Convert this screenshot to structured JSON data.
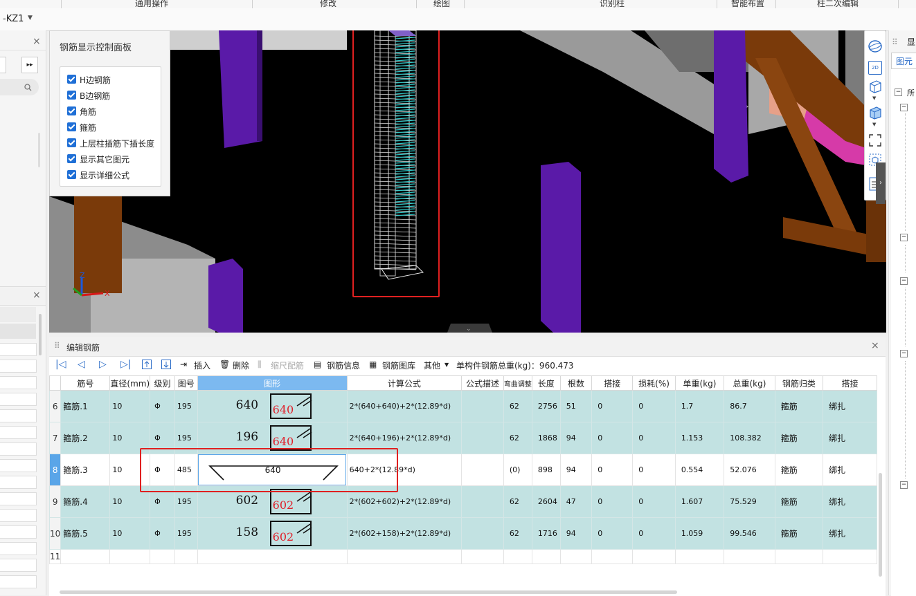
{
  "topbar": {
    "items": [
      "通用操作",
      "修改",
      "绘图",
      "识别柱",
      "智能布置",
      "柱二次编辑"
    ]
  },
  "component": {
    "name": "-KZ1"
  },
  "control_panel": {
    "title": "钢筋显示控制面板",
    "options": [
      {
        "label": "H边钢筋",
        "checked": true
      },
      {
        "label": "B边钢筋",
        "checked": true
      },
      {
        "label": "角筋",
        "checked": true
      },
      {
        "label": "箍筋",
        "checked": true
      },
      {
        "label": "上层柱插筋下插长度",
        "checked": true
      },
      {
        "label": "显示其它图元",
        "checked": true
      },
      {
        "label": "显示详细公式",
        "checked": true
      }
    ]
  },
  "view_toolbar": {
    "icons": [
      "orbit-icon",
      "2d-view-icon",
      "cube-view-icon",
      "cube-shaded-icon",
      "fit-view-icon",
      "section-box-icon",
      "list-icon"
    ],
    "label_2d": "2D"
  },
  "axis": {
    "z": "Z",
    "y": "Y",
    "x": "X"
  },
  "editor": {
    "title": "编辑钢筋",
    "toolbar": {
      "insert": "插入",
      "delete": "删除",
      "scale_rebar": "缩尺配筋",
      "rebar_info": "钢筋信息",
      "rebar_library": "钢筋图库",
      "other": "其他",
      "total_weight": "单构件钢筋总重(kg)：960.473"
    },
    "columns": [
      "",
      "筋号",
      "直径(mm)",
      "级别",
      "图号",
      "图形",
      "计算公式",
      "公式描述",
      "弯曲调整",
      "长度",
      "根数",
      "搭接",
      "损耗(%)",
      "单重(kg)",
      "总重(kg)",
      "钢筋归类",
      "搭接"
    ],
    "grade_symbol": "Φ",
    "rows": [
      {
        "n": "6",
        "name": "箍筋.1",
        "d": "10",
        "fig": "195",
        "shapeNum": "640",
        "shapeRed": "640",
        "formula": "2*(640+640)+2*(12.89*d)",
        "adj": "62",
        "len": "2756",
        "cnt": "51",
        "lap": "0",
        "loss": "0",
        "unit": "1.7",
        "total": "86.7",
        "cat": "箍筋",
        "lapType": "绑扎"
      },
      {
        "n": "7",
        "name": "箍筋.2",
        "d": "10",
        "fig": "195",
        "shapeNum": "196",
        "shapeRed": "640",
        "formula": "2*(640+196)+2*(12.89*d)",
        "adj": "62",
        "len": "1868",
        "cnt": "94",
        "lap": "0",
        "loss": "0",
        "unit": "1.153",
        "total": "108.382",
        "cat": "箍筋",
        "lapType": "绑扎"
      },
      {
        "n": "8",
        "name": "箍筋.3",
        "d": "10",
        "fig": "485",
        "shapeNum": "640",
        "shapeRed": "",
        "formula": "640+2*(12.89*d)",
        "adj": "(0)",
        "len": "898",
        "cnt": "94",
        "lap": "0",
        "loss": "0",
        "unit": "0.554",
        "total": "52.076",
        "cat": "箍筋",
        "lapType": "绑扎"
      },
      {
        "n": "9",
        "name": "箍筋.4",
        "d": "10",
        "fig": "195",
        "shapeNum": "602",
        "shapeRed": "602",
        "formula": "2*(602+602)+2*(12.89*d)",
        "adj": "62",
        "len": "2604",
        "cnt": "47",
        "lap": "0",
        "loss": "0",
        "unit": "1.607",
        "total": "75.529",
        "cat": "箍筋",
        "lapType": "绑扎"
      },
      {
        "n": "10",
        "name": "箍筋.5",
        "d": "10",
        "fig": "195",
        "shapeNum": "158",
        "shapeRed": "602",
        "formula": "2*(602+158)+2*(12.89*d)",
        "adj": "62",
        "len": "1716",
        "cnt": "94",
        "lap": "0",
        "loss": "0",
        "unit": "1.059",
        "total": "99.546",
        "cat": "箍筋",
        "lapType": "绑扎"
      },
      {
        "n": "11"
      }
    ]
  },
  "right_panel": {
    "title": "显",
    "tab": "图元显",
    "tree": [
      "所",
      "",
      "",
      "",
      "",
      ""
    ]
  },
  "colors": {
    "accent": "#2a6bc7",
    "row_bg": "#c2e2e2",
    "highlight": "#e02020",
    "column_purple": "#5a1aa8",
    "beam_brown": "#7a3a0a"
  }
}
